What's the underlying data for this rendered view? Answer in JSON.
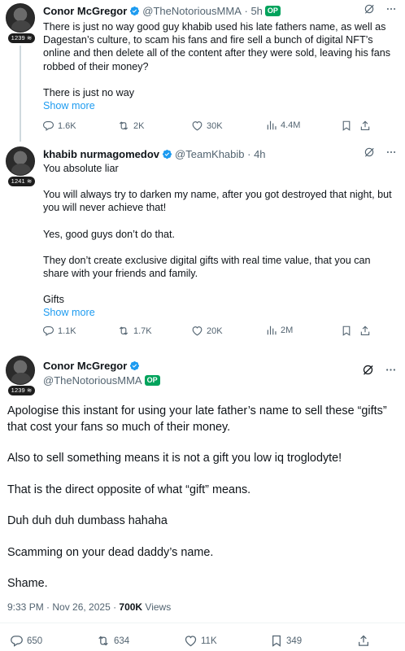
{
  "tweets": [
    {
      "name": "Conor McGregor",
      "handle": "@TheNotoriousMMA",
      "time": "5h",
      "op_label": "OP",
      "rank": "1239 ≋",
      "paragraphs": [
        "There is just no way good guy khabib used his late fathers name, as well as Dagestan’s culture, to scam his fans and fire sell a bunch of digital NFT’s online and then delete all of the content after they were sold, leaving his fans robbed of their money?",
        "There is just no way"
      ],
      "show_more": "Show more",
      "stats": {
        "replies": "1.6K",
        "reposts": "2K",
        "likes": "30K",
        "views": "4.4M"
      }
    },
    {
      "name": "khabib nurmagomedov",
      "handle": "@TeamKhabib",
      "time": "4h",
      "rank": "1241 ≋",
      "paragraphs": [
        "You absolute liar",
        "You will always try to darken my name, after you got destroyed that night, but you will never achieve that!",
        "Yes, good guys don’t do that.",
        "They don’t create exclusive digital gifts with real time value, that you can share with your friends and family.",
        "Gifts"
      ],
      "show_more": "Show more",
      "stats": {
        "replies": "1.1K",
        "reposts": "1.7K",
        "likes": "20K",
        "views": "2M"
      }
    },
    {
      "name": "Conor McGregor",
      "handle": "@TheNotoriousMMA",
      "op_label": "OP",
      "rank": "1239 ≋",
      "paragraphs": [
        "Apologise this instant for using your late father’s name to sell these “gifts” that cost your fans so much of their money.",
        "Also to sell something means it is not a gift you low iq troglodyte!",
        "That is the direct opposite of what “gift” means.",
        "Duh duh duh dumbass hahaha",
        "Scamming on your dead daddy’s name.",
        "Shame."
      ],
      "timestamp": "9:33 PM · Nov 26, 2025 · ",
      "views_count": "700K",
      "views_label": " Views",
      "stats": {
        "replies": "650",
        "reposts": "634",
        "likes": "11K",
        "bookmarks": "349"
      }
    }
  ],
  "colors": {
    "accent": "#1d9bf0",
    "op_badge": "#00a35c",
    "muted": "#536471",
    "verified": "#1d9bf0"
  }
}
